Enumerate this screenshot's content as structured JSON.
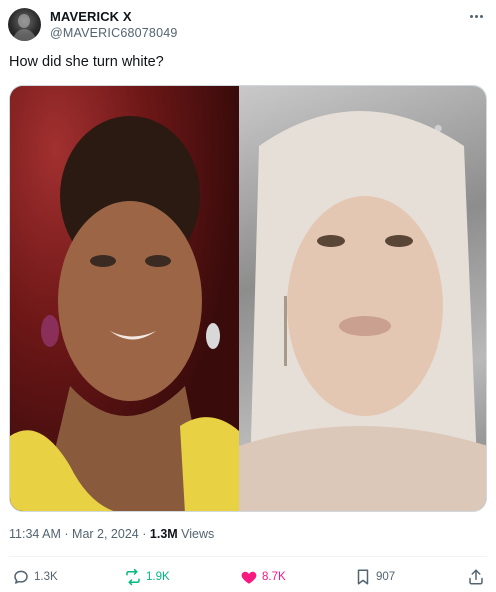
{
  "author": {
    "display_name": "MAVERICK X",
    "handle": "@MAVERIC68078049"
  },
  "tweet": {
    "text": "How did she turn white?"
  },
  "meta": {
    "time": "11:34 AM",
    "separator": "·",
    "date": "Mar 2, 2024",
    "views_count": "1.3M",
    "views_label": "Views"
  },
  "actions": {
    "replies": "1.3K",
    "reposts": "1.9K",
    "likes": "8.7K",
    "bookmarks": "907"
  },
  "colors": {
    "repost": "#00ba7c",
    "like": "#f91880",
    "muted": "#536471"
  },
  "icons": {
    "reply": "reply-icon",
    "repost": "repost-icon",
    "like": "heart-icon",
    "bookmark": "bookmark-icon",
    "share": "share-icon",
    "more": "more-icon"
  }
}
